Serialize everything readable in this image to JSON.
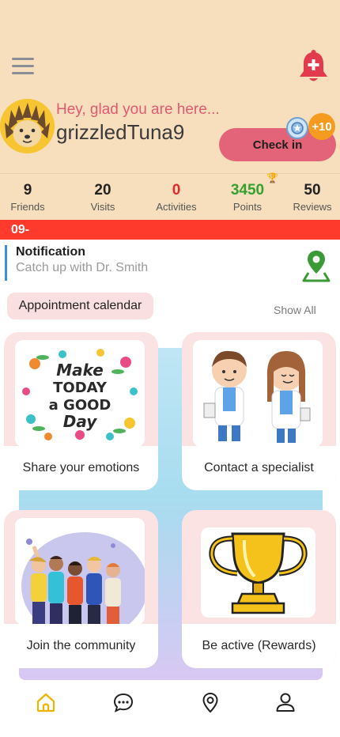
{
  "header": {
    "greeting": "Hey, glad you are here...",
    "username": "grizzledTuna9",
    "checkin_label": "Check in",
    "bonus_badge": "+10"
  },
  "stats": [
    {
      "value": "9",
      "label": "Friends",
      "color": "#222222"
    },
    {
      "value": "20",
      "label": "Visits",
      "color": "#222222"
    },
    {
      "value": "0",
      "label": "Activities",
      "color": "#e02a2a"
    },
    {
      "value": "3450",
      "label": "Points",
      "color": "#36a02f"
    },
    {
      "value": "50",
      "label": "Reviews",
      "color": "#222222"
    }
  ],
  "date_bar": "09-",
  "notification": {
    "title": "Notification",
    "subtitle": "Catch up with Dr. Smith"
  },
  "appointment": {
    "label": "Appointment calendar",
    "show_all": "Show All"
  },
  "tiles": [
    {
      "caption": "Share your emotions",
      "image_text": [
        "Make",
        "TODAY",
        "a GOOD",
        "Day"
      ]
    },
    {
      "caption": "Contact a specialist"
    },
    {
      "caption": "Join the community"
    },
    {
      "caption": "Be active (Rewards)"
    }
  ],
  "nav": [
    "home-icon",
    "chat-icon",
    "location-icon",
    "profile-icon"
  ],
  "colors": {
    "header_bg": "#f7dfbd",
    "accent_pink": "#e36478",
    "alert_red": "#fd3a2b",
    "nav_active": "#f0b300"
  }
}
